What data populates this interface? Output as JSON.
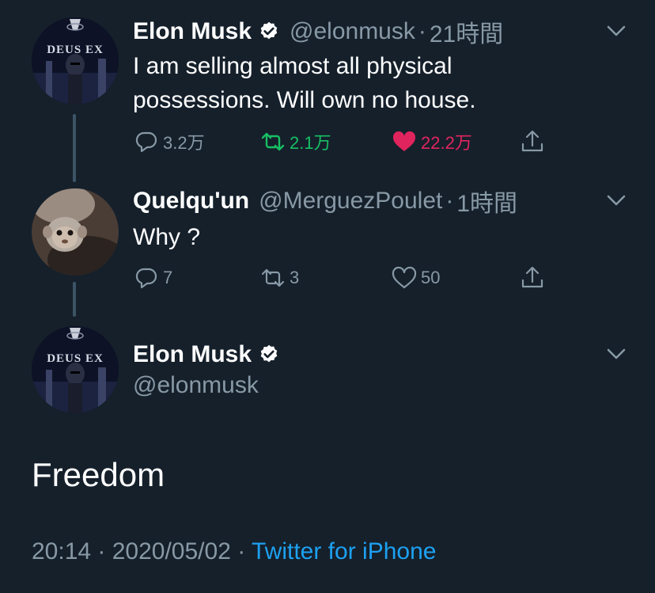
{
  "tweet1": {
    "name": "Elon Musk",
    "handle": "@elonmusk",
    "separator": "·",
    "time": "21時間",
    "text_line1": "I am selling almost all physical",
    "text_line2": "possessions. Will own no house.",
    "replies": "3.2万",
    "retweets": "2.1万",
    "likes": "22.2万",
    "avatar_logo": "DEUS EX"
  },
  "tweet2": {
    "name": "Quelqu'un",
    "handle": "@MerguezPoulet",
    "separator": "·",
    "time": "1時間",
    "text": "Why ?",
    "replies": "7",
    "retweets": "3",
    "likes": "50"
  },
  "tweet3": {
    "name": "Elon Musk",
    "handle": "@elonmusk",
    "text": "Freedom",
    "timestamp": "20:14 · 2020/05/02 · ",
    "source": "Twitter for iPhone",
    "avatar_logo": "DEUS EX"
  },
  "colors": {
    "background": "#15202b",
    "secondary_text": "#8899a6",
    "link": "#1da1f2",
    "retweet_active": "#17bf63",
    "like_active": "#e0245e"
  },
  "icons": [
    "verified-badge-icon",
    "chevron-down-icon",
    "reply-icon",
    "retweet-icon",
    "like-icon",
    "share-icon"
  ]
}
